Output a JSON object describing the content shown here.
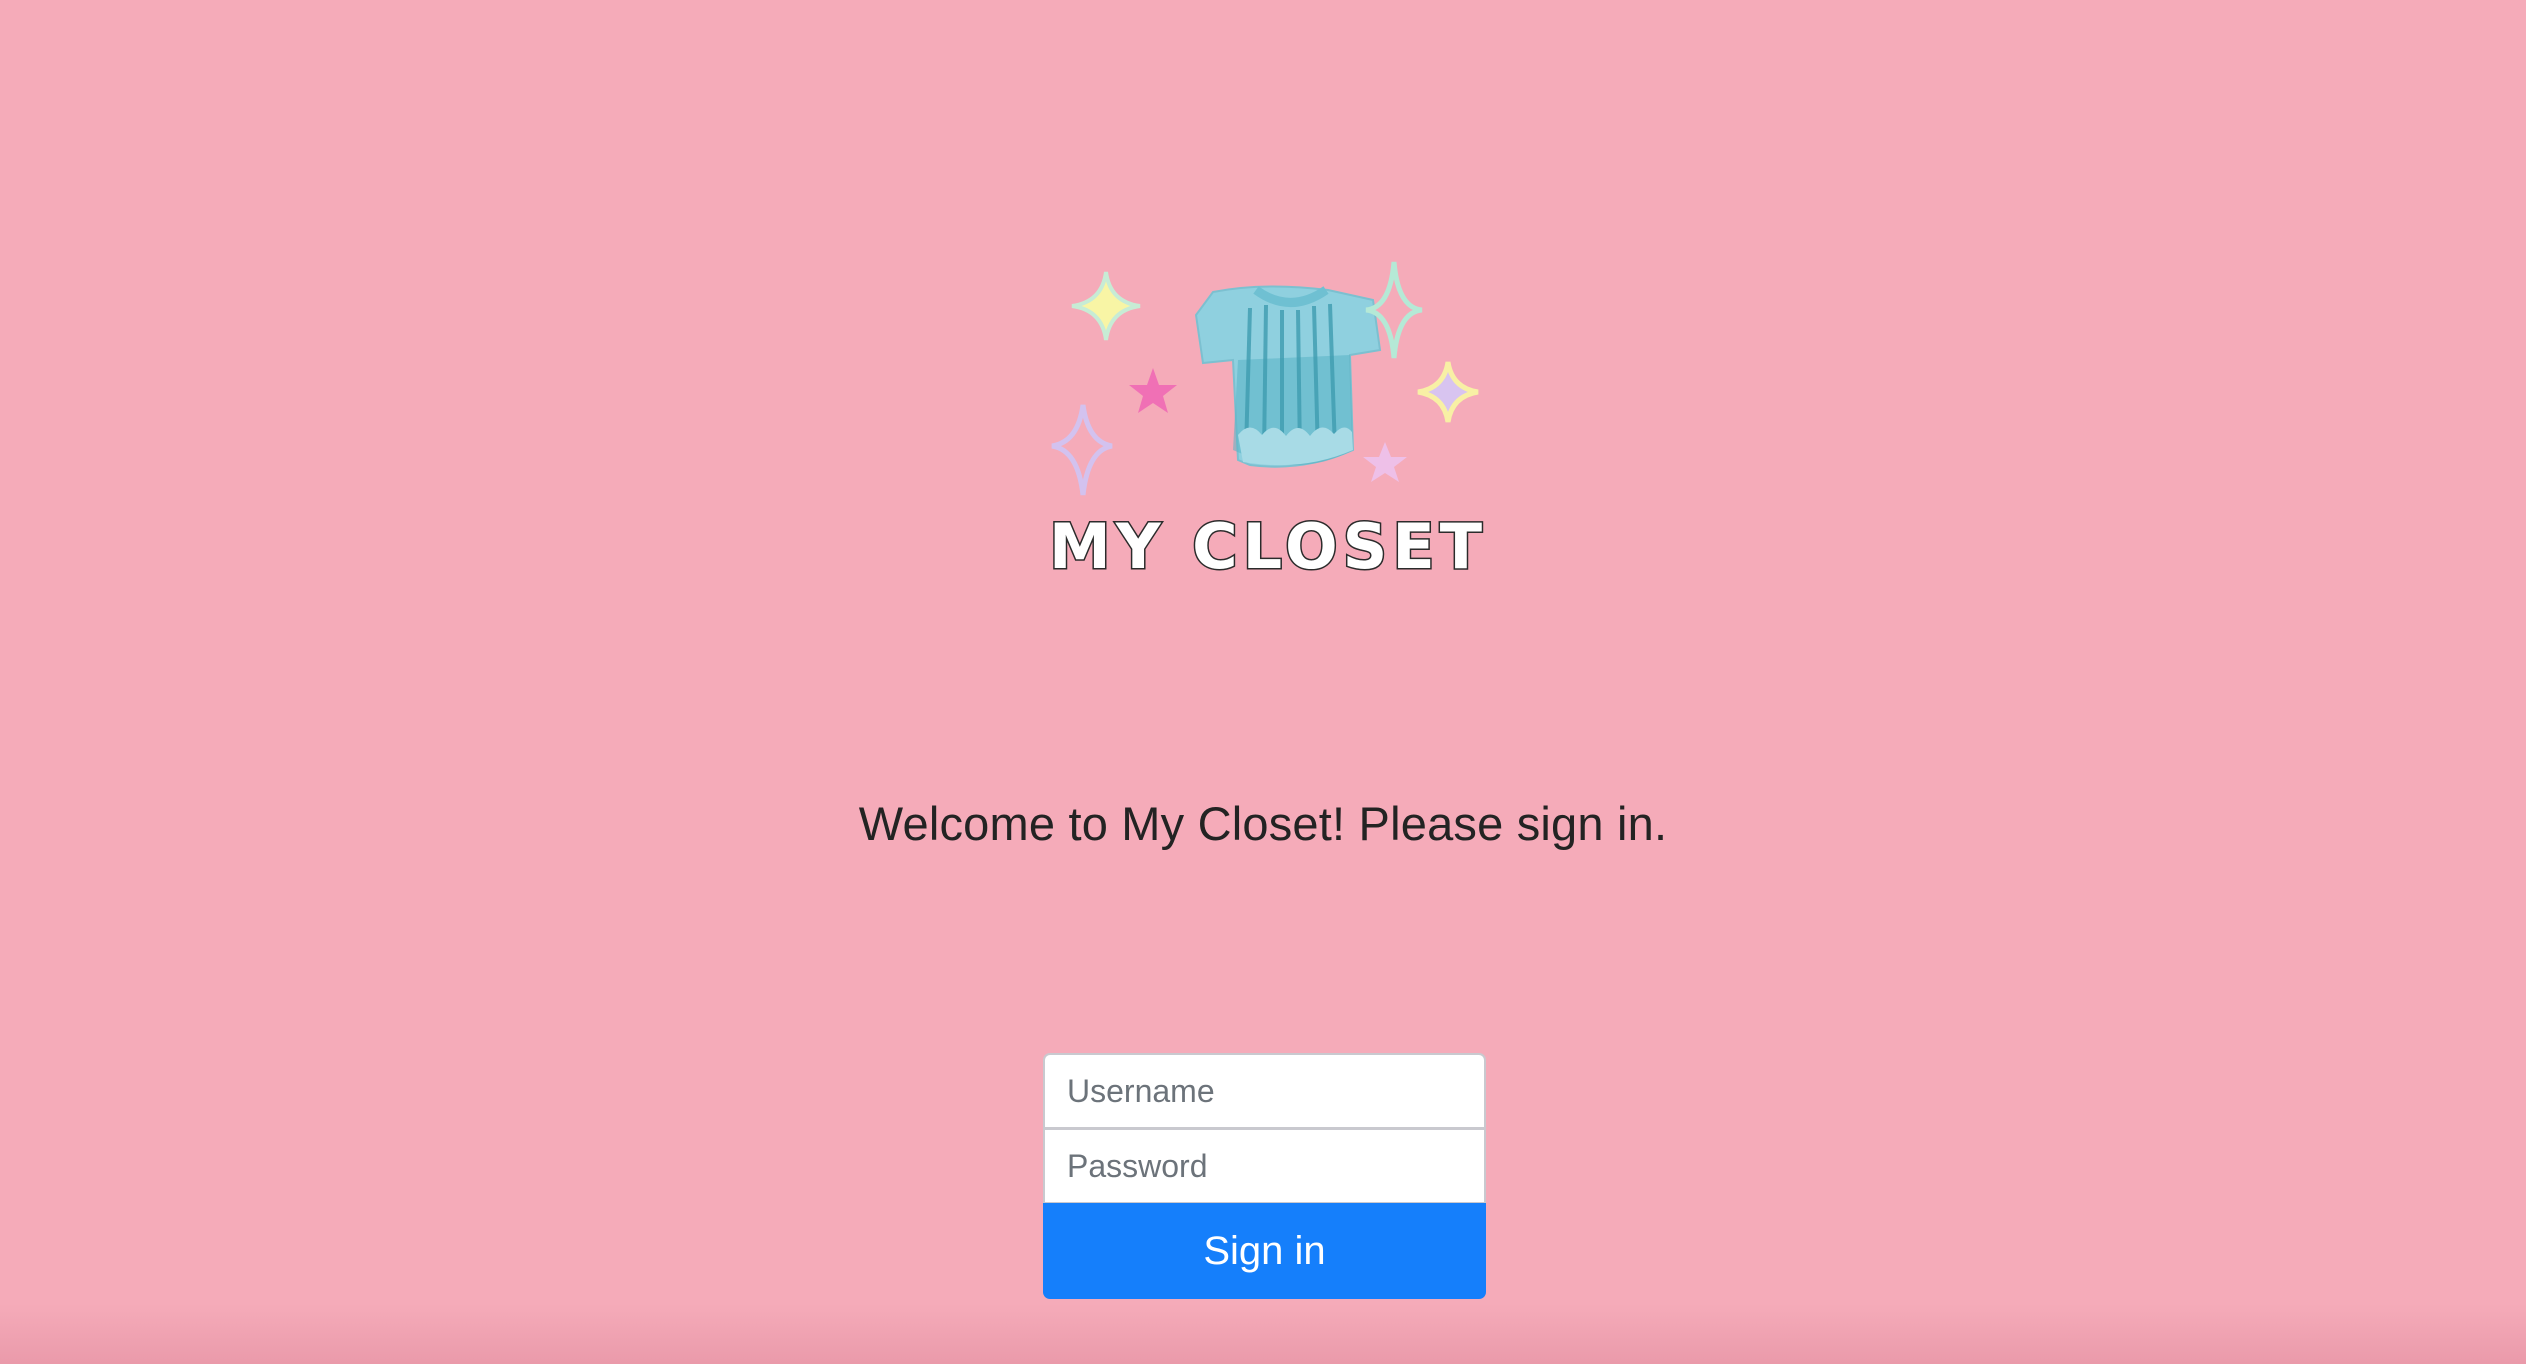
{
  "logo": {
    "title": "MY CLOSET",
    "icon": "shirt-with-sparkles-logo",
    "colors": {
      "shirt": "#8fd0df",
      "shirt_stripes": "#5ab3c4",
      "star_pink": "#f070b5",
      "sparkle_yellow": "#f8f5a5",
      "sparkle_mint": "#b5e9d6",
      "sparkle_lavender": "#d8c4f0"
    }
  },
  "welcome": {
    "text": "Welcome to My Closet! Please sign in."
  },
  "form": {
    "username_placeholder": "Username",
    "password_placeholder": "Password",
    "submit_label": "Sign in"
  },
  "colors": {
    "background": "#f5abb9",
    "primary_button": "#157ffb"
  }
}
